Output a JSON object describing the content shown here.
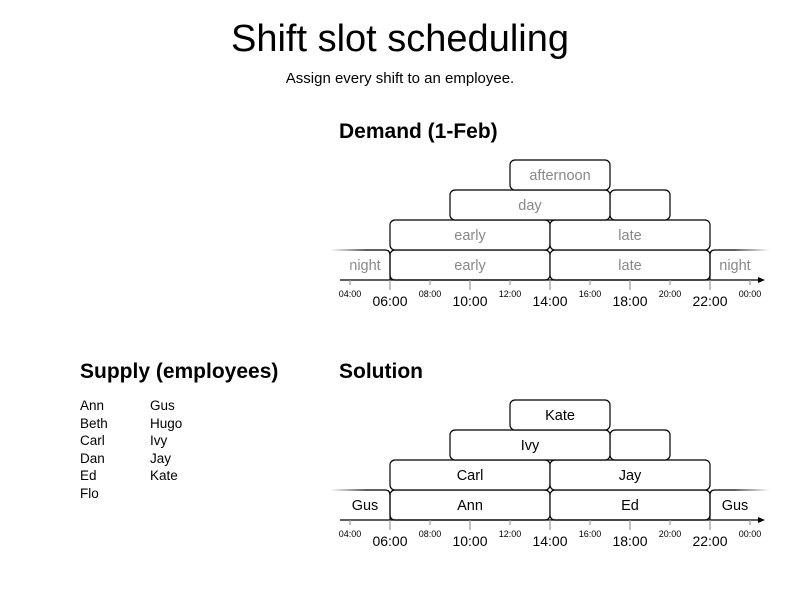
{
  "page": {
    "title": "Shift slot scheduling",
    "subtitle": "Assign every shift to an employee."
  },
  "demand": {
    "title": "Demand (1-Feb)",
    "shifts": [
      {
        "id": "afternoon",
        "label": "afternoon",
        "start": "12:00",
        "end": "20:00"
      },
      {
        "id": "day",
        "label": "day",
        "start": "09:00",
        "end": "17:00"
      },
      {
        "id": "early-1",
        "label": "early",
        "start": "06:00",
        "end": "14:00"
      },
      {
        "id": "late-1",
        "label": "late",
        "start": "14:00",
        "end": "22:00"
      },
      {
        "id": "early-2",
        "label": "early",
        "start": "06:00",
        "end": "14:00"
      },
      {
        "id": "late-2",
        "label": "late",
        "start": "14:00",
        "end": "22:00"
      },
      {
        "id": "night-prev",
        "label": "night",
        "start": "22:00",
        "end": "06:00"
      },
      {
        "id": "night-next",
        "label": "night",
        "start": "22:00",
        "end": "06:00"
      }
    ]
  },
  "supply": {
    "title": "Supply (employees)",
    "employees": [
      "Ann",
      "Beth",
      "Carl",
      "Dan",
      "Ed",
      "Flo",
      "Gus",
      "Hugo",
      "Ivy",
      "Jay",
      "Kate"
    ]
  },
  "solution": {
    "title": "Solution",
    "assignments": [
      {
        "shift": "afternoon",
        "employee": "Kate"
      },
      {
        "shift": "day",
        "employee": "Ivy"
      },
      {
        "shift": "early-1",
        "employee": "Carl"
      },
      {
        "shift": "late-1",
        "employee": "Jay"
      },
      {
        "shift": "early-2",
        "employee": "Ann"
      },
      {
        "shift": "late-2",
        "employee": "Ed"
      },
      {
        "shift": "night-prev",
        "employee": "Gus"
      },
      {
        "shift": "night-next",
        "employee": "Gus"
      }
    ]
  },
  "axis": {
    "minor_ticks": [
      "04:00",
      "08:00",
      "12:00",
      "16:00",
      "20:00",
      "00:00"
    ],
    "major_ticks": [
      "06:00",
      "10:00",
      "14:00",
      "18:00",
      "22:00"
    ]
  }
}
